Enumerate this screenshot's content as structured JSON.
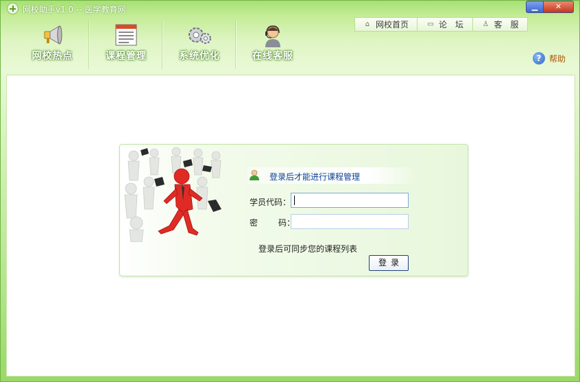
{
  "window": {
    "title": "网校助手v1.0 -- 医学教育网",
    "minimize_glyph": "▁",
    "close_glyph": "✕"
  },
  "toolbar": {
    "items": [
      {
        "label": "网校热点",
        "icon": "megaphone-icon"
      },
      {
        "label": "课程管理",
        "icon": "document-list-icon"
      },
      {
        "label": "系统优化",
        "icon": "gears-icon"
      },
      {
        "label": "在线客服",
        "icon": "headset-agent-icon"
      }
    ]
  },
  "toplinks": {
    "items": [
      {
        "label": "网校首页",
        "icon": "home-icon"
      },
      {
        "label": "论　坛",
        "icon": "forum-icon"
      },
      {
        "label": "客　服",
        "icon": "person-icon"
      }
    ]
  },
  "help": {
    "label": "帮助",
    "glyph": "?"
  },
  "login": {
    "title": "登录后才能进行课程管理",
    "student_id_label": "学员代码：",
    "password_label_a": "密",
    "password_label_b": "码：",
    "student_id_value": "",
    "password_value": "",
    "sync_note": "登录后可同步您的课程列表",
    "submit_label": "登录"
  },
  "colors": {
    "window_green": "#a7e075",
    "link_blue": "#0b3f9a",
    "help_orange": "#b2560b",
    "figure_red": "#e02b25"
  }
}
